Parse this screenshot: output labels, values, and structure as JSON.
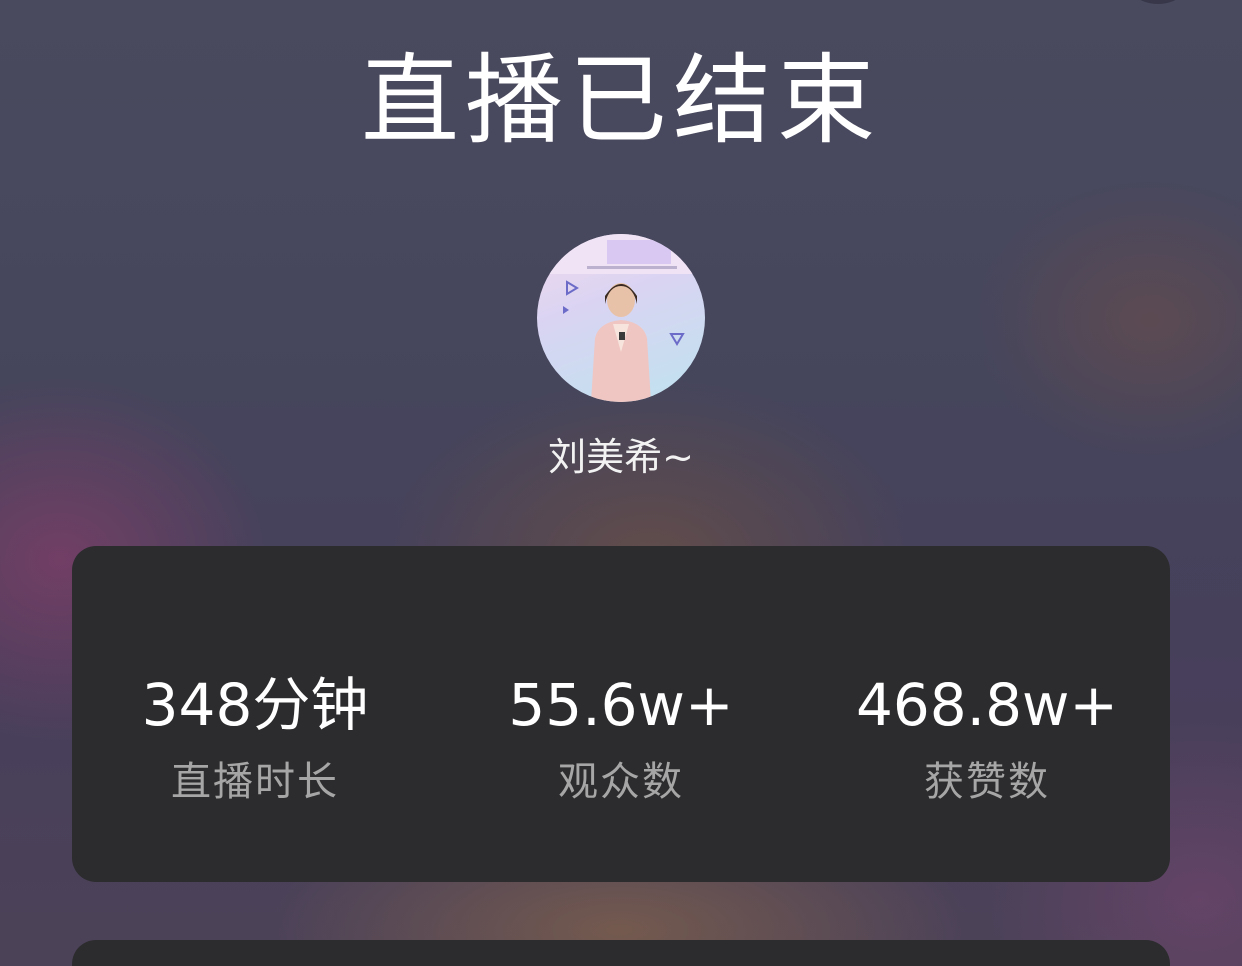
{
  "title": "直播已结束",
  "host": {
    "name": "刘美希~"
  },
  "stats": [
    {
      "value": "348分钟",
      "label": "直播时长"
    },
    {
      "value": "55.6w+",
      "label": "观众数"
    },
    {
      "value": "468.8w+",
      "label": "获赞数"
    }
  ],
  "colors": {
    "card_bg": "#2c2c2e",
    "label": "#a6a6a6",
    "text": "#ffffff"
  }
}
